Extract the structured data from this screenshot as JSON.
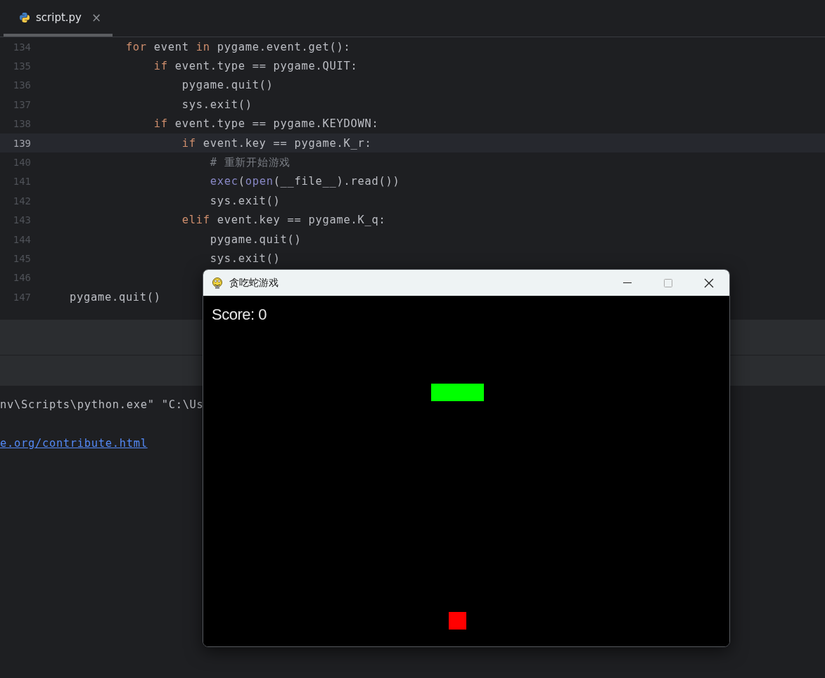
{
  "tabs": [
    {
      "label": "script.py",
      "selected": true,
      "close": "×"
    }
  ],
  "editor": {
    "lines": [
      {
        "number": "134",
        "current": false,
        "tokens": [
          {
            "kind": "keyword",
            "text": "        for"
          },
          {
            "kind": "plain",
            "text": " event "
          },
          {
            "kind": "keyword",
            "text": "in"
          },
          {
            "kind": "plain",
            "text": " pygame.event.get():"
          }
        ]
      },
      {
        "number": "135",
        "current": false,
        "tokens": [
          {
            "kind": "keyword",
            "text": "            if"
          },
          {
            "kind": "plain",
            "text": " event.type == pygame.QUIT:"
          }
        ]
      },
      {
        "number": "136",
        "current": false,
        "tokens": [
          {
            "kind": "plain",
            "text": "                pygame.quit()"
          }
        ]
      },
      {
        "number": "137",
        "current": false,
        "tokens": [
          {
            "kind": "plain",
            "text": "                sys.exit()"
          }
        ]
      },
      {
        "number": "138",
        "current": false,
        "tokens": [
          {
            "kind": "keyword",
            "text": "            if"
          },
          {
            "kind": "plain",
            "text": " event.type == pygame.KEYDOWN:"
          }
        ]
      },
      {
        "number": "139",
        "current": true,
        "tokens": [
          {
            "kind": "keyword",
            "text": "                if"
          },
          {
            "kind": "plain",
            "text": " event.key == pygame.K_r:"
          }
        ]
      },
      {
        "number": "140",
        "current": false,
        "tokens": [
          {
            "kind": "comment",
            "text": "                    # 重新开始游戏"
          }
        ]
      },
      {
        "number": "141",
        "current": false,
        "tokens": [
          {
            "kind": "builtin",
            "text": "                    exec"
          },
          {
            "kind": "plain",
            "text": "("
          },
          {
            "kind": "builtin",
            "text": "open"
          },
          {
            "kind": "plain",
            "text": "(__file__).read())"
          }
        ]
      },
      {
        "number": "142",
        "current": false,
        "tokens": [
          {
            "kind": "plain",
            "text": "                    sys.exit()"
          }
        ]
      },
      {
        "number": "143",
        "current": false,
        "tokens": [
          {
            "kind": "keyword",
            "text": "                elif"
          },
          {
            "kind": "plain",
            "text": " event.key == pygame.K_q:"
          }
        ]
      },
      {
        "number": "144",
        "current": false,
        "tokens": [
          {
            "kind": "plain",
            "text": "                    pygame.quit()"
          }
        ]
      },
      {
        "number": "145",
        "current": false,
        "tokens": [
          {
            "kind": "plain",
            "text": "                    sys.exit()"
          }
        ]
      },
      {
        "number": "146",
        "current": false
      },
      {
        "number": "147",
        "current": false,
        "tokens": [
          {
            "kind": "plain",
            "text": "pygame.quit()"
          }
        ]
      }
    ]
  },
  "console": {
    "lines": [
      {
        "kind": "text",
        "text": "nv\\Scripts\\python.exe\" \"C:\\Us"
      },
      {
        "kind": "link",
        "text": "e.org/contribute.html"
      }
    ]
  },
  "game_window": {
    "title": "贪吃蛇游戏",
    "score": "Score: 0"
  }
}
